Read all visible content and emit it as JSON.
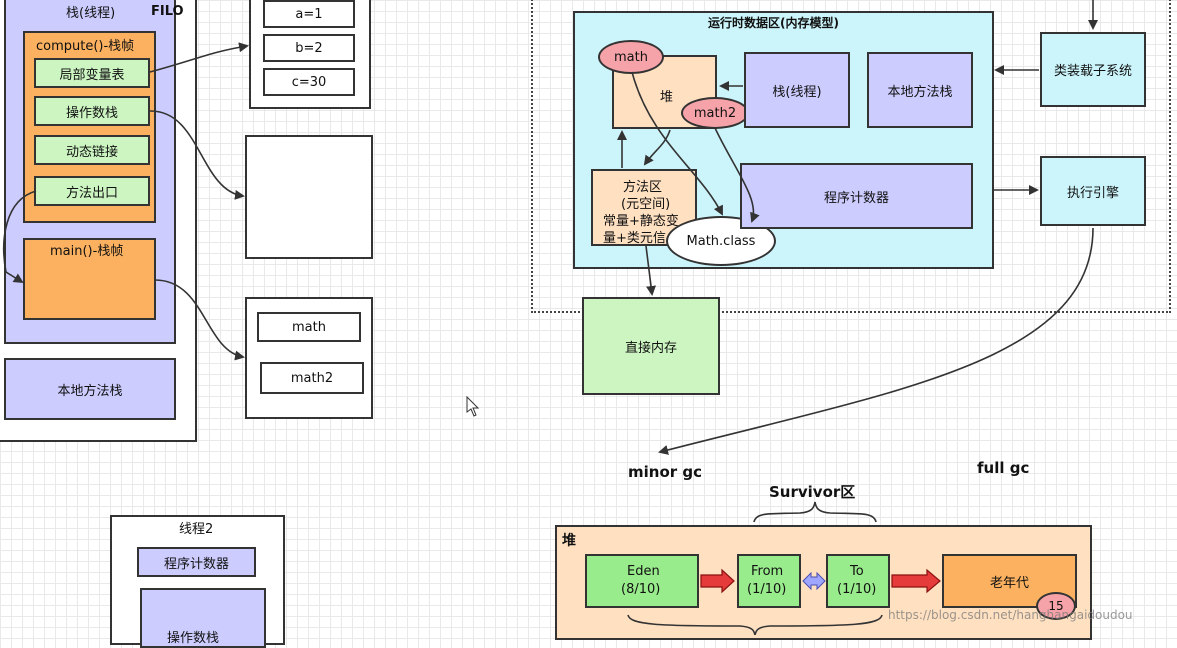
{
  "stack": {
    "title": "栈(线程)",
    "filo": "FILO",
    "compute_frame": "compute()-栈帧",
    "items": [
      "局部变量表",
      "操作数栈",
      "动态链接",
      "方法出口"
    ],
    "main_frame": "main()-栈帧",
    "native": "本地方法栈"
  },
  "locals": [
    "a=1",
    "b=2",
    "c=30"
  ],
  "heap_refs": [
    "math",
    "math2"
  ],
  "runtime": {
    "title": "运行时数据区(内存模型)",
    "heap": "堆",
    "math": "math",
    "math2": "math2",
    "stack": "栈(线程)",
    "native": "本地方法栈",
    "method_area": [
      "方法区",
      "(元空间)",
      "常量+静态变",
      "量+类元信"
    ],
    "math_class": "Math.class",
    "pc": "程序计数器"
  },
  "classloader": "类装载子系统",
  "engine": "执行引擎",
  "direct_memory": "直接内存",
  "gc": {
    "minor": "minor gc",
    "full": "full gc",
    "survivor": "Survivor区"
  },
  "heap_gen": {
    "title": "堆",
    "eden": [
      "Eden",
      "(8/10)"
    ],
    "from": [
      "From",
      "(1/10)"
    ],
    "to": [
      "To",
      "(1/10)"
    ],
    "old": "老年代",
    "age": "15"
  },
  "thread2": {
    "title": "线程2",
    "pc": "程序计数器",
    "partial": "操作数栈"
  },
  "watermark": "https://blog.csdn.net/hanghangaidoudou"
}
